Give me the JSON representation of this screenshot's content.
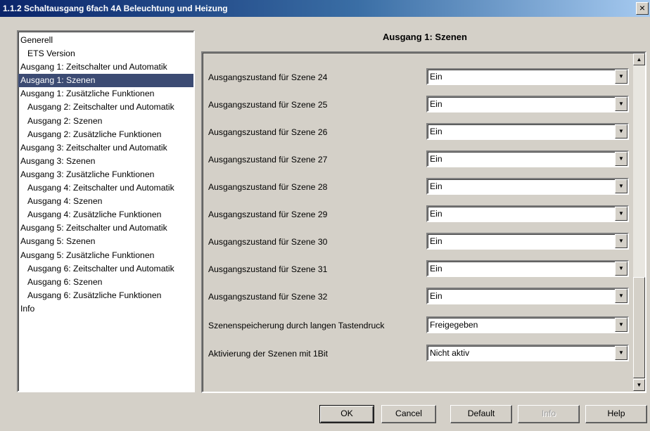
{
  "window": {
    "title": "1.1.2 Schaltausgang 6fach 4A Beleuchtung und Heizung",
    "close_glyph": "×"
  },
  "tree": {
    "items": [
      {
        "label": "Generell",
        "level": 1,
        "selected": false
      },
      {
        "label": "ETS Version",
        "level": 2,
        "selected": false
      },
      {
        "label": "Ausgang 1: Zeitschalter und Automatik",
        "level": 1,
        "selected": false
      },
      {
        "label": "Ausgang 1: Szenen",
        "level": 1,
        "selected": true
      },
      {
        "label": "Ausgang 1: Zusätzliche Funktionen",
        "level": 1,
        "selected": false
      },
      {
        "label": "Ausgang 2: Zeitschalter und Automatik",
        "level": 2,
        "selected": false
      },
      {
        "label": "Ausgang 2: Szenen",
        "level": 2,
        "selected": false
      },
      {
        "label": "Ausgang 2: Zusätzliche Funktionen",
        "level": 2,
        "selected": false
      },
      {
        "label": "Ausgang 3: Zeitschalter und Automatik",
        "level": 1,
        "selected": false
      },
      {
        "label": "Ausgang 3: Szenen",
        "level": 1,
        "selected": false
      },
      {
        "label": "Ausgang 3: Zusätzliche Funktionen",
        "level": 1,
        "selected": false
      },
      {
        "label": "Ausgang 4: Zeitschalter und Automatik",
        "level": 2,
        "selected": false
      },
      {
        "label": "Ausgang 4: Szenen",
        "level": 2,
        "selected": false
      },
      {
        "label": "Ausgang 4: Zusätzliche Funktionen",
        "level": 2,
        "selected": false
      },
      {
        "label": "Ausgang 5: Zeitschalter und Automatik",
        "level": 1,
        "selected": false
      },
      {
        "label": "Ausgang 5: Szenen",
        "level": 1,
        "selected": false
      },
      {
        "label": "Ausgang 5: Zusätzliche Funktionen",
        "level": 1,
        "selected": false
      },
      {
        "label": "Ausgang 6: Zeitschalter und Automatik",
        "level": 2,
        "selected": false
      },
      {
        "label": "Ausgang 6: Szenen",
        "level": 2,
        "selected": false
      },
      {
        "label": "Ausgang 6: Zusätzliche Funktionen",
        "level": 2,
        "selected": false
      },
      {
        "label": "Info",
        "level": 1,
        "selected": false
      }
    ]
  },
  "panel": {
    "title": "Ausgang 1: Szenen",
    "parameters": [
      {
        "label": "Ausgangszustand für Szene 24",
        "value": "Ein"
      },
      {
        "label": "Ausgangszustand für Szene 25",
        "value": "Ein"
      },
      {
        "label": "Ausgangszustand für Szene 26",
        "value": "Ein"
      },
      {
        "label": "Ausgangszustand für Szene 27",
        "value": "Ein"
      },
      {
        "label": "Ausgangszustand für Szene 28",
        "value": "Ein"
      },
      {
        "label": "Ausgangszustand für Szene 29",
        "value": "Ein"
      },
      {
        "label": "Ausgangszustand für Szene 30",
        "value": "Ein"
      },
      {
        "label": "Ausgangszustand für Szene 31",
        "value": "Ein"
      },
      {
        "label": "Ausgangszustand für Szene 32",
        "value": "Ein"
      },
      {
        "label": "Szenenspeicherung durch langen Tastendruck",
        "value": "Freigegeben"
      },
      {
        "label": "Aktivierung der Szenen mit 1Bit",
        "value": "Nicht aktiv"
      }
    ],
    "dropdown_glyph": "▼",
    "scroll_up_glyph": "▲",
    "scroll_down_glyph": "▼"
  },
  "buttons": {
    "ok": "OK",
    "cancel": "Cancel",
    "default": "Default",
    "info": "Info",
    "help": "Help"
  }
}
